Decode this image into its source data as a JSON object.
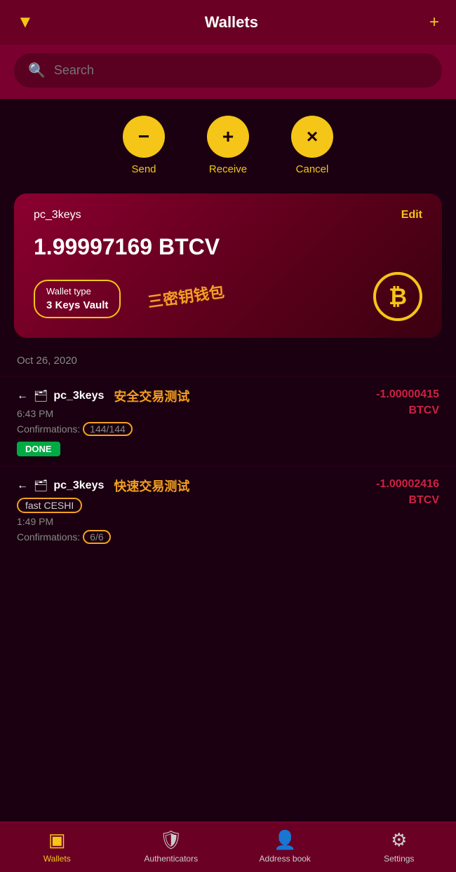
{
  "header": {
    "title": "Wallets",
    "filter_icon": "▼",
    "add_icon": "+"
  },
  "search": {
    "placeholder": "Search"
  },
  "actions": [
    {
      "id": "send",
      "icon": "−",
      "label": "Send"
    },
    {
      "id": "receive",
      "icon": "+",
      "label": "Receive"
    },
    {
      "id": "cancel",
      "icon": "×",
      "label": "Cancel"
    }
  ],
  "wallet_card": {
    "name": "pc_3keys",
    "edit_label": "Edit",
    "balance": "1.99997169 BTCV",
    "type_label": "Wallet type",
    "type_value": "3 Keys Vault",
    "annotation": "三密钥钱包"
  },
  "date_section": {
    "label": "Oct 26, 2020"
  },
  "transactions": [
    {
      "id": "tx1",
      "direction": "←",
      "wallet": "pc_3keys",
      "annotation": "安全交易测试",
      "time": "6:43 PM",
      "confirmations_label": "Confirmations:",
      "confirmations": "144/144",
      "status": "DONE",
      "amount": "-1.00000415",
      "currency": "BTCV"
    },
    {
      "id": "tx2",
      "direction": "←",
      "wallet": "pc_3keys",
      "annotation": "快速交易测试",
      "sublabel": "fast CESHI",
      "time": "1:49 PM",
      "confirmations_label": "Confirmations:",
      "confirmations": "6/6",
      "status": null,
      "amount": "-1.00002416",
      "currency": "BTCV"
    }
  ],
  "bottom_nav": [
    {
      "id": "wallets",
      "icon": "▣",
      "label": "Wallets",
      "active": true
    },
    {
      "id": "authenticators",
      "icon": "🛡",
      "label": "Authenticators",
      "active": false
    },
    {
      "id": "address-book",
      "icon": "👤",
      "label": "Address book",
      "active": false
    },
    {
      "id": "settings",
      "icon": "⚙",
      "label": "Settings",
      "active": false
    }
  ]
}
